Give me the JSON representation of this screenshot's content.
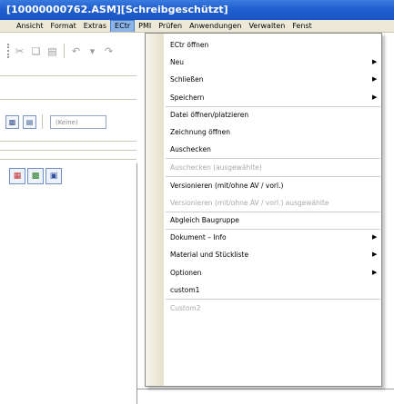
{
  "window": {
    "title": "[10000000762.ASM][Schreibgeschützt]"
  },
  "menubar": {
    "items": [
      "Ansicht",
      "Format",
      "Extras",
      "ECtr",
      "PMI",
      "Prüfen",
      "Anwendungen",
      "Verwalten",
      "Fenst"
    ],
    "active": "ECtr"
  },
  "toolbar": {
    "filter_value": "(Keine)"
  },
  "dropdown": {
    "items": [
      {
        "label": "ECtr öffnen",
        "disabled": false,
        "submenu": false
      },
      {
        "label": "Neu",
        "disabled": false,
        "submenu": true
      },
      {
        "label": "Schließen",
        "disabled": false,
        "submenu": true
      },
      {
        "label": "Speichern",
        "disabled": false,
        "submenu": true
      },
      {
        "label": "Datei öffnen/platzieren",
        "disabled": false,
        "submenu": false
      },
      {
        "label": "Zeichnung öffnen",
        "disabled": false,
        "submenu": false
      },
      {
        "label": "Auschecken",
        "disabled": false,
        "submenu": false
      },
      {
        "label": "Auschecken (ausgewählte)",
        "disabled": true,
        "submenu": false
      },
      {
        "label": "Versionieren (mit/ohne AV / vorl.)",
        "disabled": false,
        "submenu": false
      },
      {
        "label": "Versionieren (mit/ohne AV / vorl.) ausgewählte",
        "disabled": true,
        "submenu": false
      },
      {
        "label": "Abgleich Baugruppe",
        "disabled": false,
        "submenu": false
      },
      {
        "label": "Dokument – Info",
        "disabled": false,
        "submenu": true
      },
      {
        "label": "Material und Stückliste",
        "disabled": false,
        "submenu": true
      },
      {
        "label": "Optionen",
        "disabled": false,
        "submenu": true
      },
      {
        "label": "custom1",
        "disabled": false,
        "submenu": false
      },
      {
        "label": "Custom2",
        "disabled": true,
        "submenu": false
      }
    ]
  }
}
